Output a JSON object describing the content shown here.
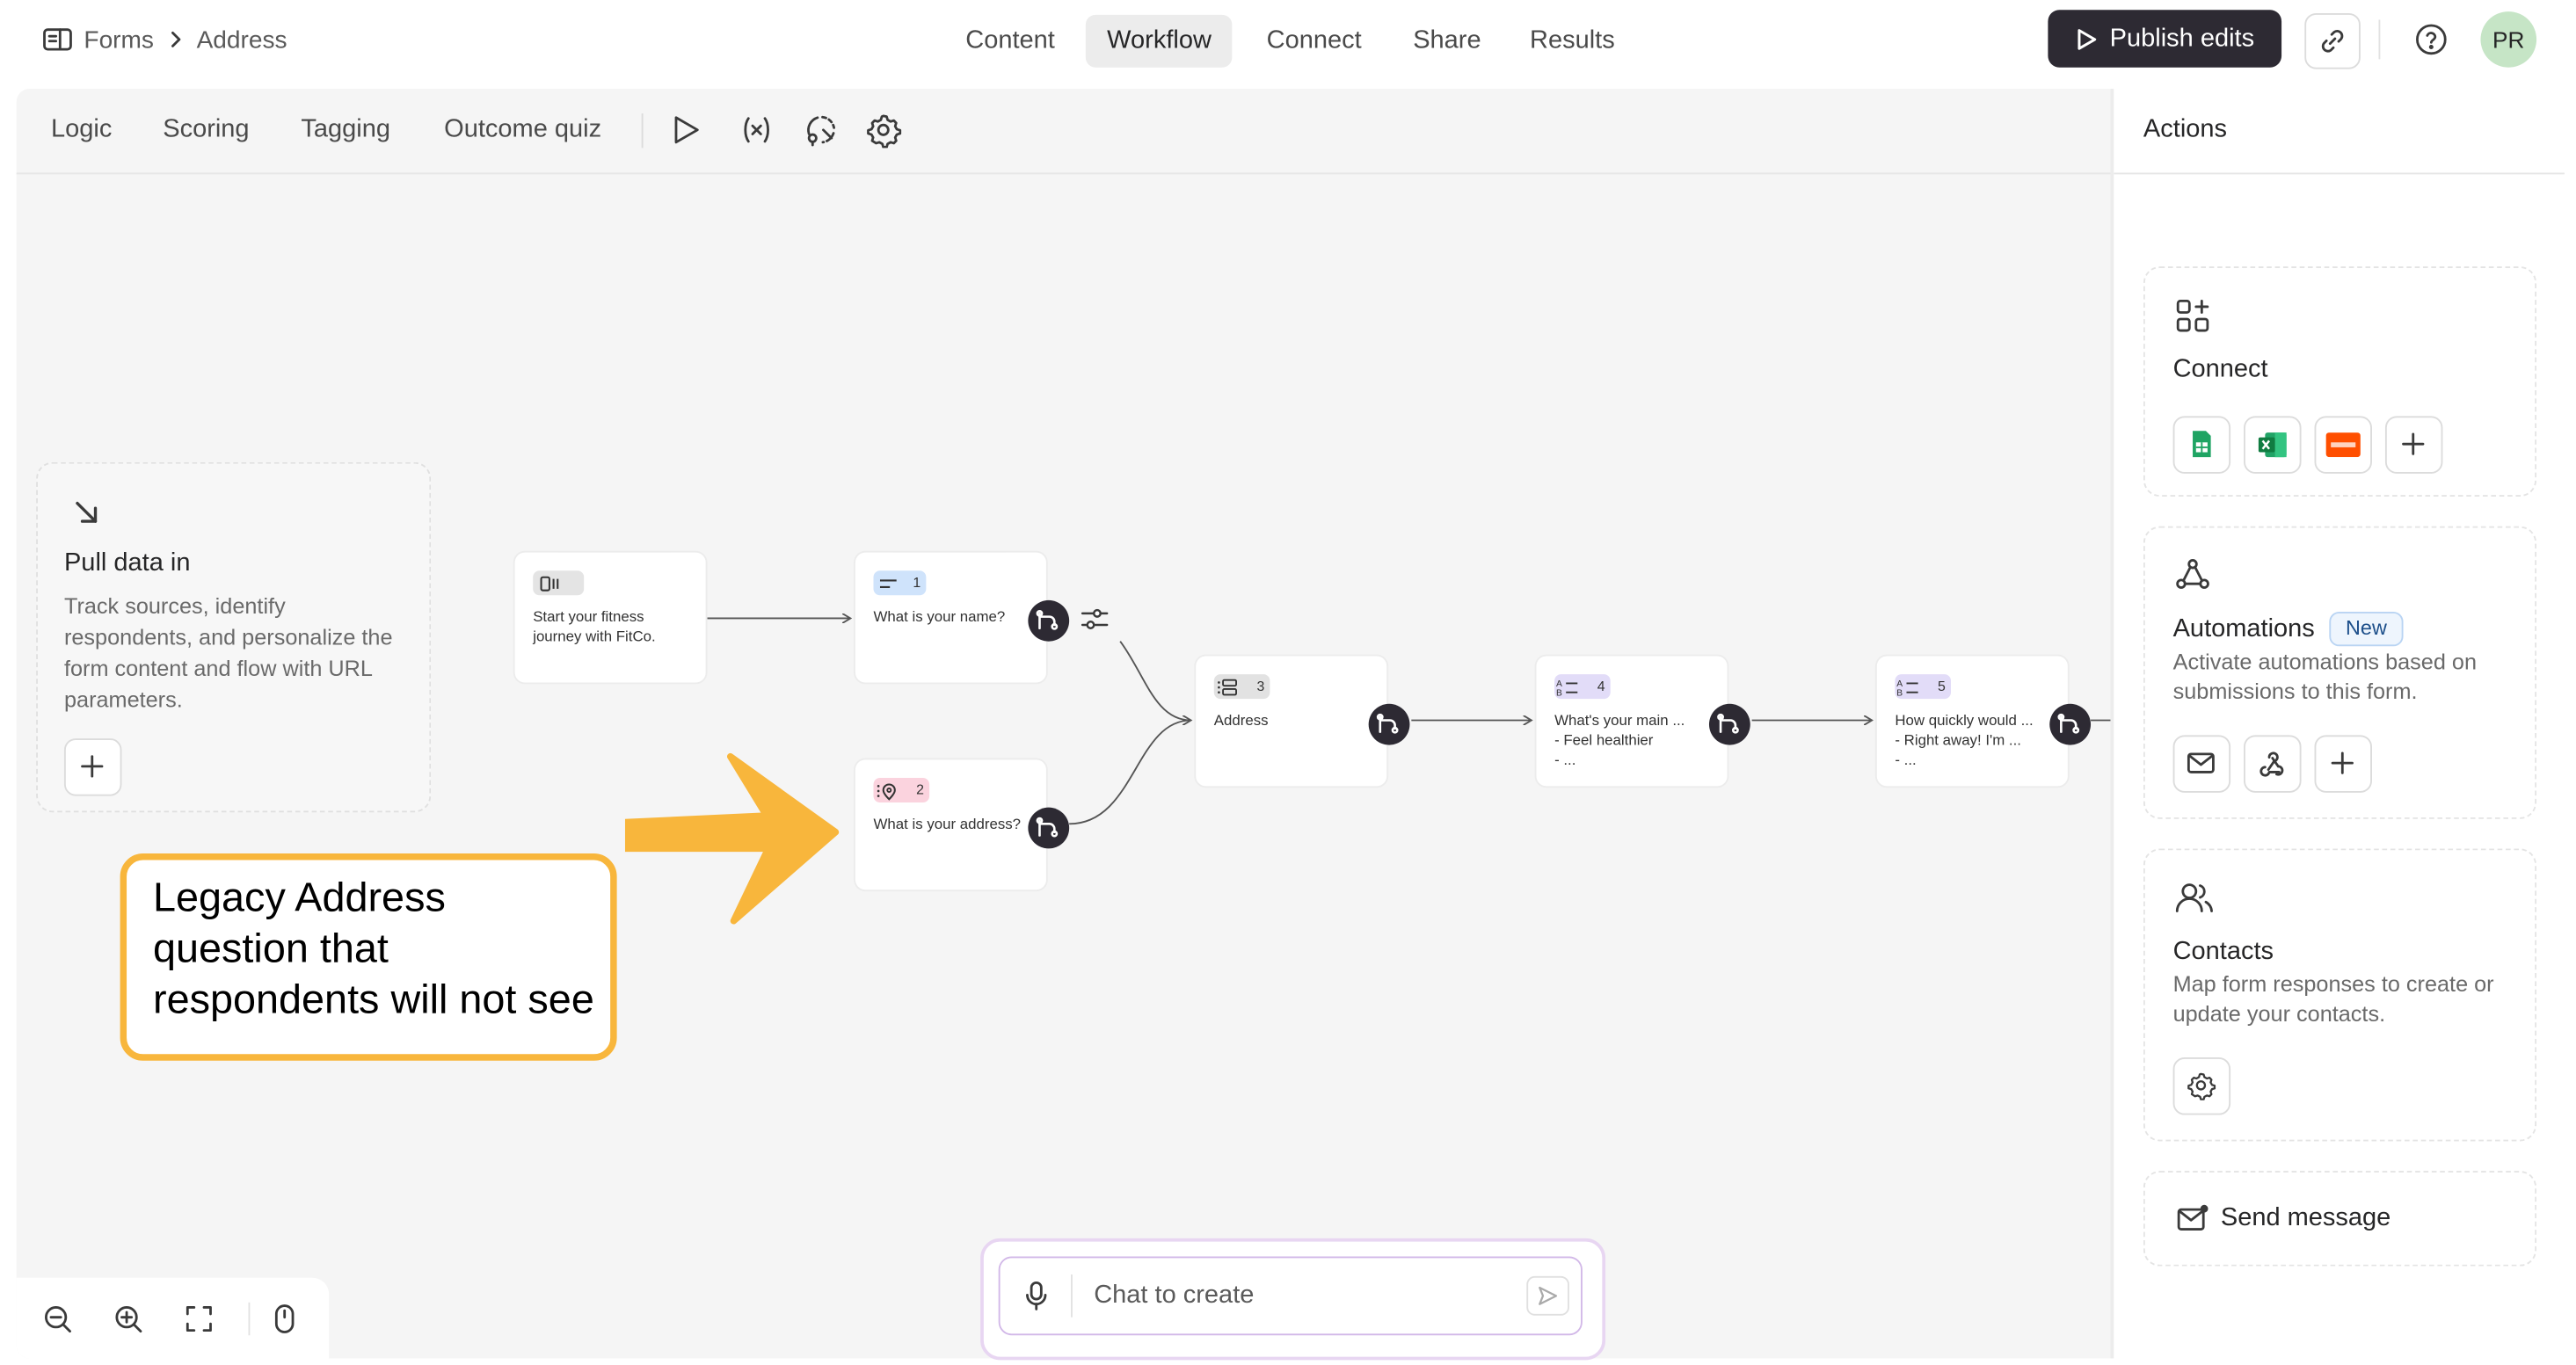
{
  "breadcrumb": {
    "root": "Forms",
    "current": "Address"
  },
  "top_tabs": [
    {
      "label": "Content"
    },
    {
      "label": "Workflow"
    },
    {
      "label": "Connect"
    },
    {
      "label": "Share"
    },
    {
      "label": "Results"
    }
  ],
  "active_top_tab": "Workflow",
  "publish_label": "Publish edits",
  "avatar_initials": "PR",
  "sub_tabs": [
    {
      "label": "Logic"
    },
    {
      "label": "Scoring"
    },
    {
      "label": "Tagging"
    },
    {
      "label": "Outcome quiz"
    }
  ],
  "toolbar_icons": [
    "play-icon",
    "variable-icon",
    "lasso-icon",
    "settings-icon"
  ],
  "pull_data": {
    "title": "Pull data in",
    "description": "Track sources, identify respondents, and personalize the form content and flow with URL parameters."
  },
  "nodes": {
    "welcome": {
      "text": "Start your fitness journey with FitCo."
    },
    "q1": {
      "number": "1",
      "text": "What is your name?"
    },
    "q2": {
      "number": "2",
      "text": "What is your address?"
    },
    "q3": {
      "number": "3",
      "text": "Address"
    },
    "q4": {
      "number": "4",
      "line1": "What's your main ...",
      "line2": "- Feel healthier",
      "line3": "- ..."
    },
    "q5": {
      "number": "5",
      "line1": "How quickly would ...",
      "line2": "- Right away! I'm ...",
      "line3": "- ..."
    }
  },
  "annotation": {
    "text": "Legacy Address question that respondents will not see",
    "color": "#f8b63c"
  },
  "chat": {
    "placeholder": "Chat to create"
  },
  "actions_panel": {
    "title": "Actions",
    "connect": {
      "title": "Connect",
      "integrations": [
        "google-sheets-icon",
        "excel-icon",
        "zapier-icon"
      ]
    },
    "automations": {
      "title": "Automations",
      "badge": "New",
      "description": "Activate automations based on submissions to this form."
    },
    "contacts": {
      "title": "Contacts",
      "description": "Map form responses to create or update your contacts."
    },
    "send_message": {
      "title": "Send message"
    }
  },
  "colors": {
    "publish_bg": "#2d2a33",
    "canvas_bg": "#f5f5f5",
    "badge_short_text": "#cfe3fb",
    "badge_address": "#fbd3de",
    "badge_multi_address": "#e2e2e2",
    "badge_choice": "#e2dcf8",
    "avatar_bg": "#c6e5c6"
  }
}
